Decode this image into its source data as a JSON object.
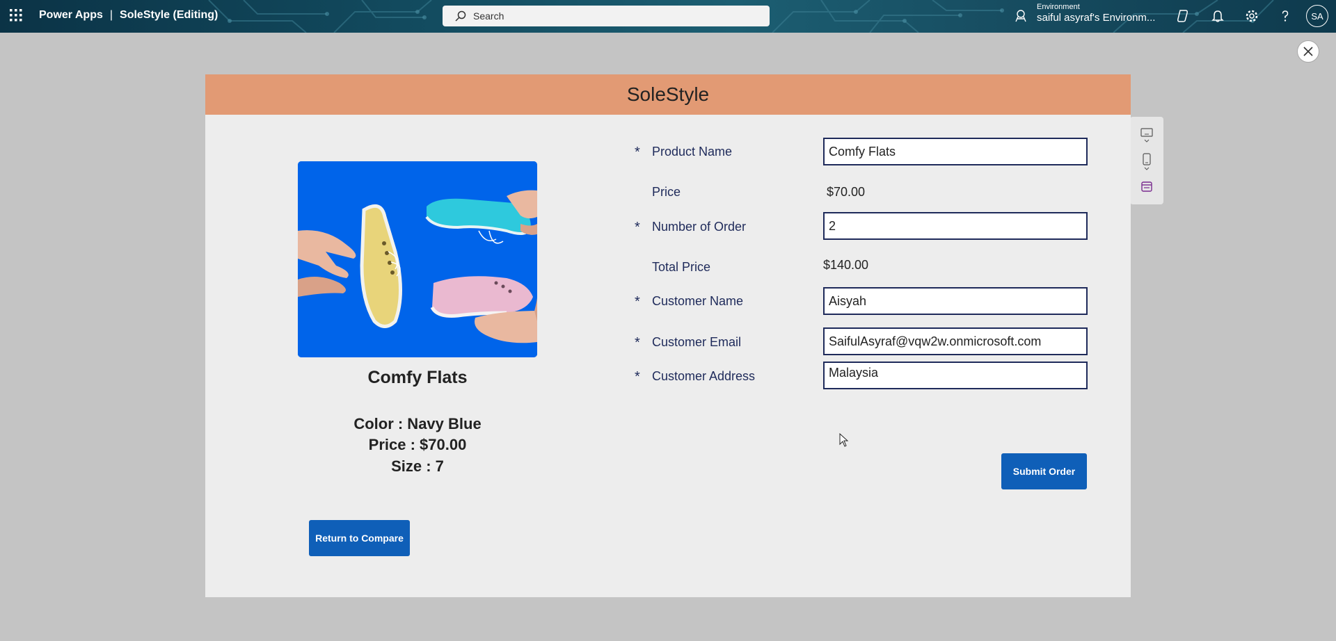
{
  "topbar": {
    "app_name": "Power Apps",
    "separator": "|",
    "app_title": "SoleStyle (Editing)",
    "search_placeholder": "Search",
    "environment_label": "Environment",
    "environment_value": "saiful asyraf's Environm...",
    "avatar_initials": "SA",
    "icons": [
      "waffle-icon",
      "search-icon",
      "environment-icon",
      "copilot-icon",
      "notifications-icon",
      "settings-icon",
      "help-icon"
    ]
  },
  "app": {
    "header_title": "SoleStyle",
    "product": {
      "name": "Comfy Flats",
      "color_line": "Color : Navy Blue",
      "price_line": "Price : $70.00",
      "size_line": "Size : 7"
    },
    "form": {
      "required_marker": "*",
      "product_name_label": "Product Name",
      "product_name_value": "Comfy Flats",
      "price_label": "Price",
      "price_value": "$70.00",
      "order_count_label": "Number of Order",
      "order_count_value": "2",
      "total_price_label": "Total Price",
      "total_price_value": "$140.00",
      "customer_name_label": "Customer Name",
      "customer_name_value": "Aisyah",
      "customer_email_label": "Customer Email",
      "customer_email_value": "SaifulAsyraf@vqw2w.onmicrosoft.com",
      "customer_address_label": "Customer Address",
      "customer_address_value": "Malaysia"
    },
    "submit_label": "Submit Order",
    "return_label": "Return to Compare"
  },
  "colors": {
    "header_bg": "#e29a74",
    "button_bg": "#0f5fb8",
    "image_bg": "#0064ea",
    "label_text": "#1e2a5a"
  }
}
